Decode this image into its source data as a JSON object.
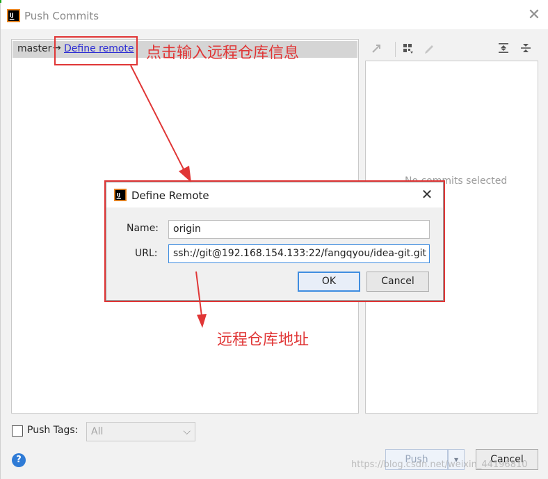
{
  "window": {
    "title": "Push Commits",
    "close_glyph": "✕"
  },
  "branch": {
    "local": "master",
    "arrow": "→",
    "define_link": "Define remote"
  },
  "toolbar": {
    "icons": [
      "push-arrow-icon",
      "group-by-icon",
      "edit-icon",
      "expand-all-icon",
      "collapse-all-icon"
    ]
  },
  "commits_panel": {
    "empty_text": "No commits selected"
  },
  "bottom": {
    "push_tags_label": "Push Tags:",
    "tags_select_value": "All",
    "help_glyph": "?",
    "push_label": "Push",
    "push_dropdown_glyph": "▾",
    "cancel_label": "Cancel"
  },
  "dialog": {
    "title": "Define Remote",
    "close_glyph": "✕",
    "name_label": "Name:",
    "name_value": "origin",
    "url_label": "URL:",
    "url_value": "ssh://git@192.168.154.133:22/fangqyou/idea-git.git",
    "ok_label": "OK",
    "cancel_label": "Cancel"
  },
  "annotations": {
    "click_hint": "点击输入远程仓库信息",
    "url_hint": "远程仓库地址",
    "color": "#e03636"
  },
  "watermark": "https://blog.csdn.net/weixin_44196810"
}
